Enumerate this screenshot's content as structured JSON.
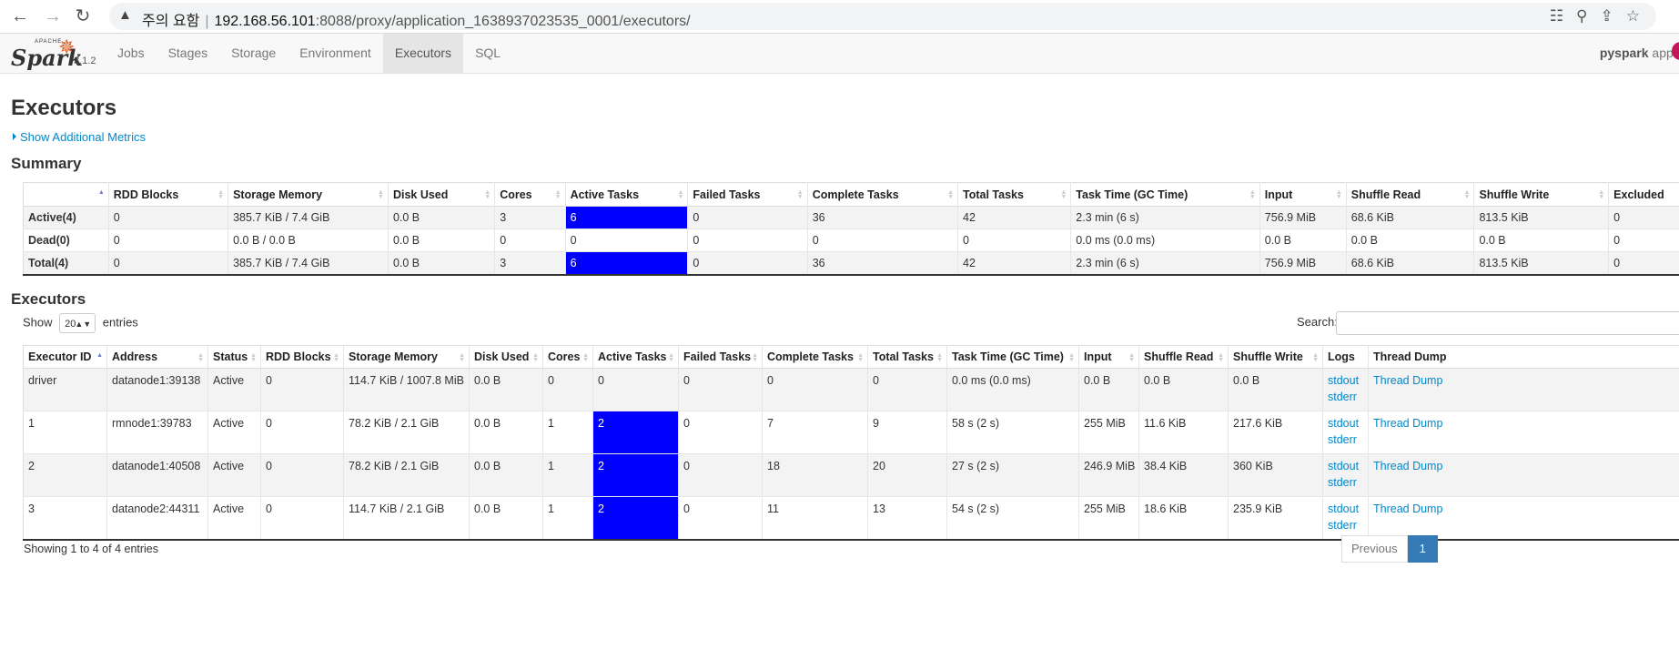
{
  "browser": {
    "warning_text": "주의 요함",
    "url_host": "192.168.56.101",
    "url_port_path": ":8088/proxy/application_1638937023535_0001/executors/"
  },
  "navbar": {
    "logo_text": "Spark",
    "logo_apache": "APACHE",
    "version": "3.1.2",
    "tabs": [
      {
        "label": "Jobs"
      },
      {
        "label": "Stages"
      },
      {
        "label": "Storage"
      },
      {
        "label": "Environment"
      },
      {
        "label": "Executors",
        "active": true
      },
      {
        "label": "SQL"
      }
    ],
    "app_name_bold": "pyspark",
    "app_name_rest": " appli"
  },
  "page": {
    "title": "Executors",
    "additional_metrics": "Show Additional Metrics",
    "summary_title": "Summary",
    "executors_title": "Executors"
  },
  "summary": {
    "headers": [
      "",
      "RDD Blocks",
      "Storage Memory",
      "Disk Used",
      "Cores",
      "Active Tasks",
      "Failed Tasks",
      "Complete Tasks",
      "Total Tasks",
      "Task Time (GC Time)",
      "Input",
      "Shuffle Read",
      "Shuffle Write",
      "Excluded"
    ],
    "rows": [
      {
        "label": "Active(4)",
        "rdd": "0",
        "storage": "385.7 KiB / 7.4 GiB",
        "disk": "0.0 B",
        "cores": "3",
        "active": "6",
        "failed": "0",
        "complete": "36",
        "total": "42",
        "task_time": "2.3 min (6 s)",
        "input": "756.9 MiB",
        "shuffle_read": "68.6 KiB",
        "shuffle_write": "813.5 KiB",
        "excluded": "0"
      },
      {
        "label": "Dead(0)",
        "rdd": "0",
        "storage": "0.0 B / 0.0 B",
        "disk": "0.0 B",
        "cores": "0",
        "active": "0",
        "failed": "0",
        "complete": "0",
        "total": "0",
        "task_time": "0.0 ms (0.0 ms)",
        "input": "0.0 B",
        "shuffle_read": "0.0 B",
        "shuffle_write": "0.0 B",
        "excluded": "0"
      },
      {
        "label": "Total(4)",
        "rdd": "0",
        "storage": "385.7 KiB / 7.4 GiB",
        "disk": "0.0 B",
        "cores": "3",
        "active": "6",
        "failed": "0",
        "complete": "36",
        "total": "42",
        "task_time": "2.3 min (6 s)",
        "input": "756.9 MiB",
        "shuffle_read": "68.6 KiB",
        "shuffle_write": "813.5 KiB",
        "excluded": "0"
      }
    ]
  },
  "controls": {
    "show_label": "Show",
    "page_size": "20",
    "entries_label": "entries",
    "search_label": "Search:"
  },
  "executors": {
    "headers": [
      "Executor ID",
      "Address",
      "Status",
      "RDD Blocks",
      "Storage Memory",
      "Disk Used",
      "Cores",
      "Active Tasks",
      "Failed Tasks",
      "Complete Tasks",
      "Total Tasks",
      "Task Time (GC Time)",
      "Input",
      "Shuffle Read",
      "Shuffle Write",
      "Logs",
      "Thread Dump"
    ],
    "rows": [
      {
        "id": "driver",
        "address": "datanode1:39138",
        "status": "Active",
        "rdd": "0",
        "storage": "114.7 KiB / 1007.8 MiB",
        "disk": "0.0 B",
        "cores": "0",
        "active": "0",
        "failed": "0",
        "complete": "0",
        "total": "0",
        "task_time": "0.0 ms (0.0 ms)",
        "input": "0.0 B",
        "shuffle_read": "0.0 B",
        "shuffle_write": "0.0 B",
        "stdout": "stdout",
        "stderr": "stderr",
        "thread_dump": "Thread Dump"
      },
      {
        "id": "1",
        "address": "rmnode1:39783",
        "status": "Active",
        "rdd": "0",
        "storage": "78.2 KiB / 2.1 GiB",
        "disk": "0.0 B",
        "cores": "1",
        "active": "2",
        "failed": "0",
        "complete": "7",
        "total": "9",
        "task_time": "58 s (2 s)",
        "input": "255 MiB",
        "shuffle_read": "11.6 KiB",
        "shuffle_write": "217.6 KiB",
        "stdout": "stdout",
        "stderr": "stderr",
        "thread_dump": "Thread Dump"
      },
      {
        "id": "2",
        "address": "datanode1:40508",
        "status": "Active",
        "rdd": "0",
        "storage": "78.2 KiB / 2.1 GiB",
        "disk": "0.0 B",
        "cores": "1",
        "active": "2",
        "failed": "0",
        "complete": "18",
        "total": "20",
        "task_time": "27 s (2 s)",
        "input": "246.9 MiB",
        "shuffle_read": "38.4 KiB",
        "shuffle_write": "360 KiB",
        "stdout": "stdout",
        "stderr": "stderr",
        "thread_dump": "Thread Dump"
      },
      {
        "id": "3",
        "address": "datanode2:44311",
        "status": "Active",
        "rdd": "0",
        "storage": "114.7 KiB / 2.1 GiB",
        "disk": "0.0 B",
        "cores": "1",
        "active": "2",
        "failed": "0",
        "complete": "11",
        "total": "13",
        "task_time": "54 s (2 s)",
        "input": "255 MiB",
        "shuffle_read": "18.6 KiB",
        "shuffle_write": "235.9 KiB",
        "stdout": "stdout",
        "stderr": "stderr",
        "thread_dump": "Thread Dump"
      }
    ]
  },
  "footer": {
    "showing": "Showing 1 to 4 of 4 entries",
    "previous": "Previous",
    "current_page": "1"
  },
  "colors": {
    "active_tasks_highlight": "#0000ff",
    "link": "#0088cc",
    "spark_orange": "#e25a1c"
  }
}
